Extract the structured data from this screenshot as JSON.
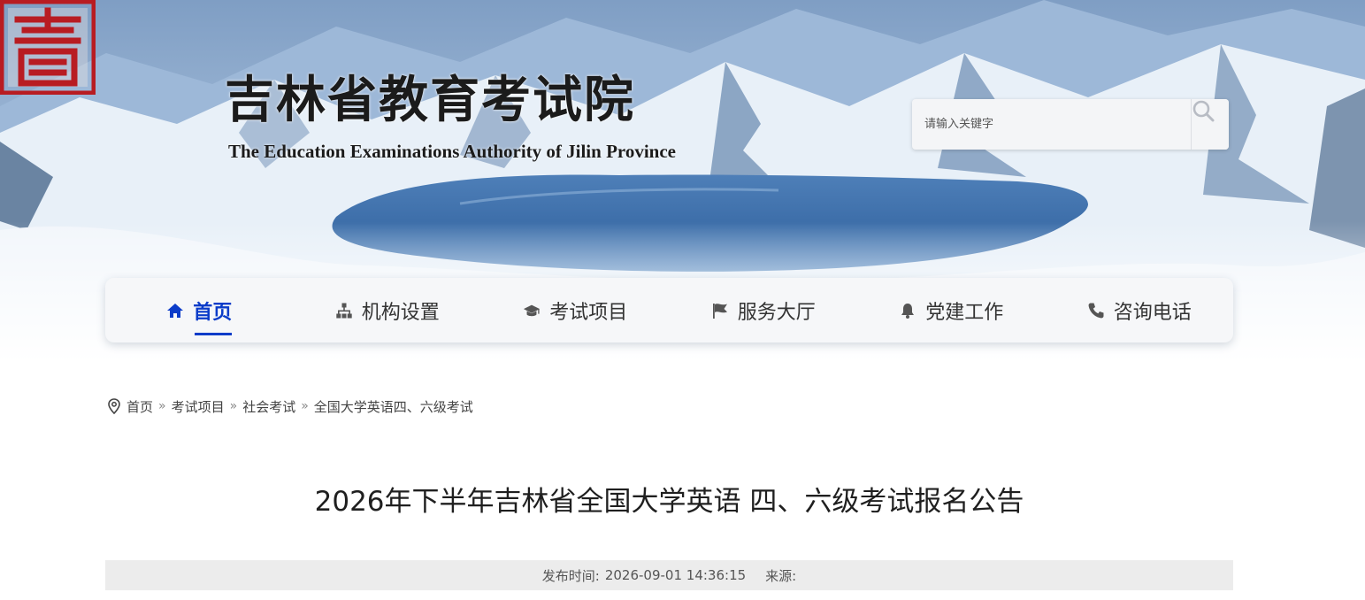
{
  "header": {
    "title": "吉林省教育考试院",
    "subtitle": "The Education Examinations Authority of Jilin Province",
    "seal_color": "#b81c22"
  },
  "search": {
    "placeholder": "请输入关键字",
    "value": ""
  },
  "nav": {
    "accent_color": "#0b3cc9",
    "items": [
      {
        "label": "首页",
        "icon": "home-icon",
        "active": true
      },
      {
        "label": "机构设置",
        "icon": "sitemap-icon",
        "active": false
      },
      {
        "label": "考试项目",
        "icon": "graduation-cap-icon",
        "active": false
      },
      {
        "label": "服务大厅",
        "icon": "flag-icon",
        "active": false
      },
      {
        "label": "党建工作",
        "icon": "bell-icon",
        "active": false
      },
      {
        "label": "咨询电话",
        "icon": "phone-icon",
        "active": false
      }
    ]
  },
  "breadcrumb": {
    "icon": "location-pin-icon",
    "separator": "»",
    "items": [
      "首页",
      "考试项目",
      "社会考试",
      "全国大学英语四、六级考试"
    ]
  },
  "article": {
    "title": "2026年下半年吉林省全国大学英语 四、六级考试报名公告",
    "publish_label": "发布时间:",
    "publish_time": "2026-09-01 14:36:15",
    "source_label": "来源:",
    "source_value": ""
  }
}
